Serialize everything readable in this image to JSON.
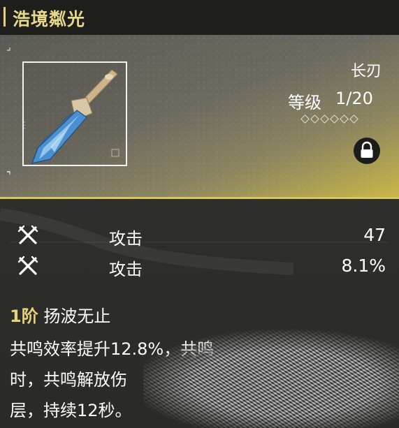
{
  "weapon": {
    "name": "浩境粼光",
    "type": "长刃",
    "level_label": "等级",
    "level_value": "1/20",
    "rank_diamonds_total": 6,
    "locked": true
  },
  "stats": [
    {
      "icon": "crossed-swords-icon",
      "name": "攻击",
      "value": "47"
    },
    {
      "icon": "crossed-swords-icon",
      "name": "攻击",
      "value": "8.1%"
    }
  ],
  "passive": {
    "rank": "1阶",
    "name": "扬波无止",
    "desc_lines": [
      "共鸣效率提升12.8%，共鸣",
      "时，共鸣解放伤",
      "层，持续12秒。"
    ]
  },
  "colors": {
    "accent_gold": "#e8d477",
    "hero_glow": "#c9b648"
  }
}
